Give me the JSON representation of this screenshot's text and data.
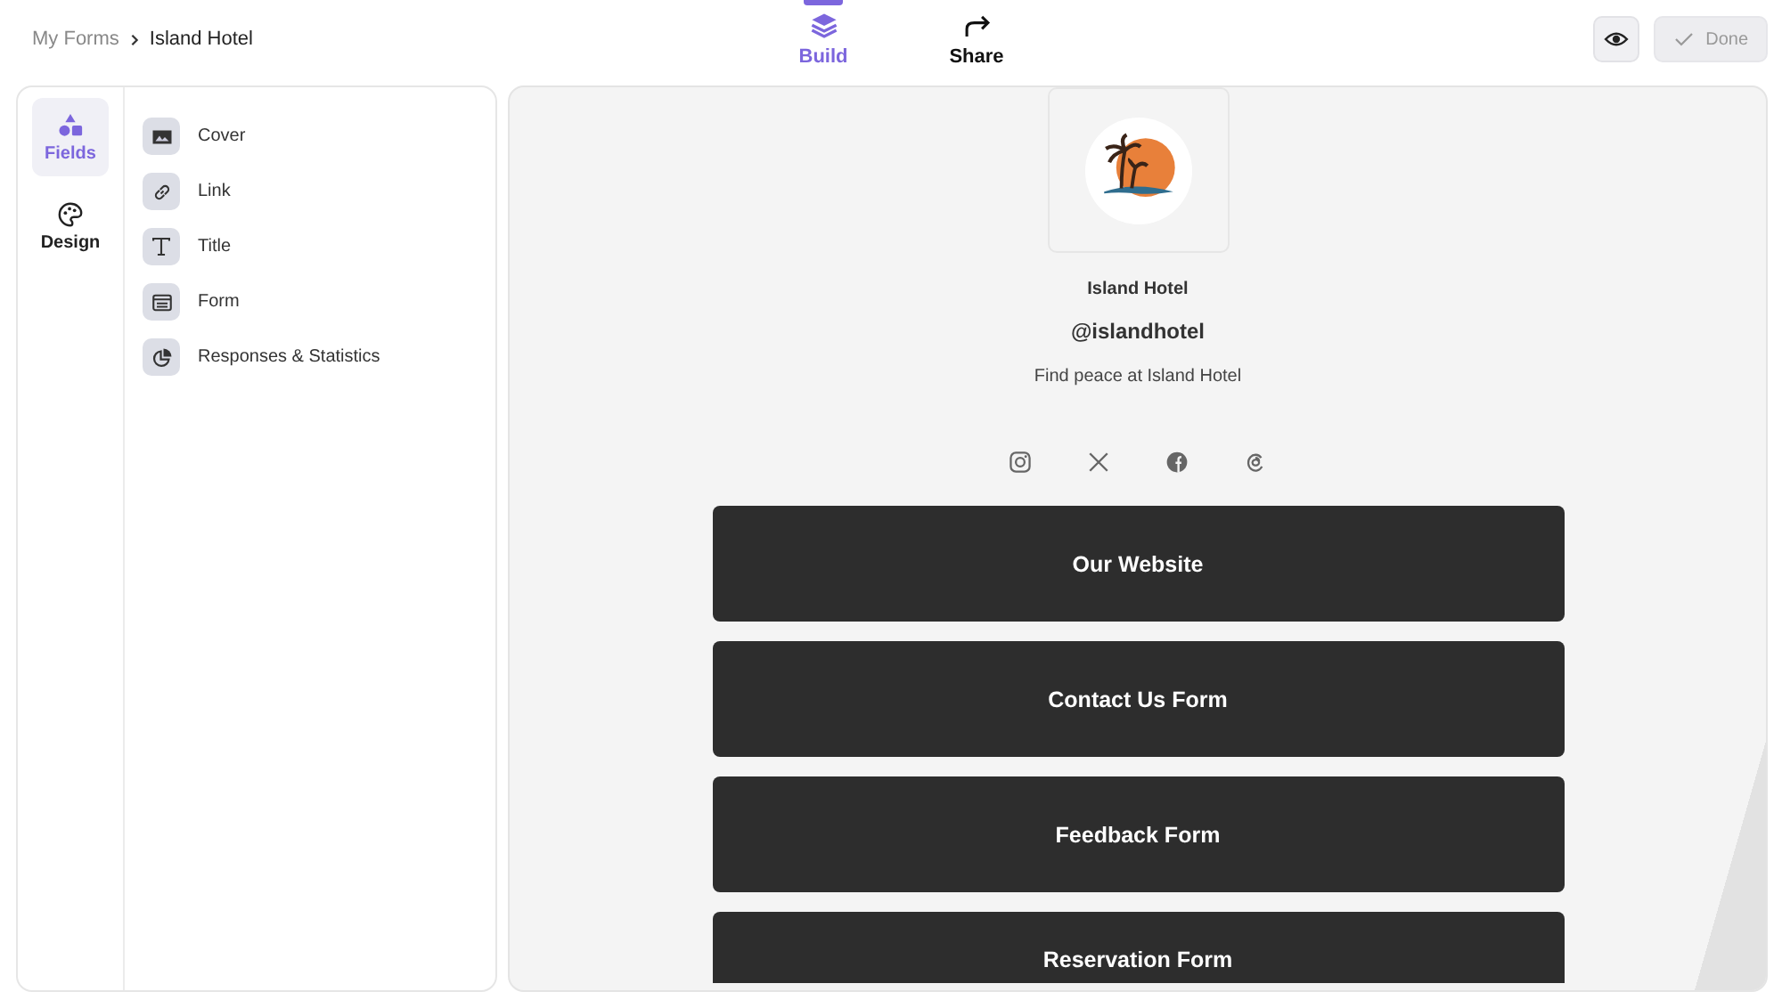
{
  "breadcrumb": [
    "My Forms",
    "Island Hotel"
  ],
  "tabs": [
    {
      "label": "Build",
      "kind": "build",
      "selected": true
    },
    {
      "label": "Share",
      "kind": "share",
      "selected": false
    }
  ],
  "actions": {
    "done": "Done"
  },
  "rail": [
    {
      "label": "Fields",
      "kind": "fields",
      "selected": true
    },
    {
      "label": "Design",
      "kind": "design",
      "selected": false
    }
  ],
  "fields": [
    {
      "label": "Cover",
      "kind": "cover"
    },
    {
      "label": "Link",
      "kind": "link"
    },
    {
      "label": "Title",
      "kind": "title"
    },
    {
      "label": "Form",
      "kind": "form"
    },
    {
      "label": "Responses & Statistics",
      "kind": "stats"
    }
  ],
  "profile": {
    "name": "Island Hotel",
    "handle": "@islandhotel",
    "bio": "Find peace at Island Hotel",
    "socials": [
      {
        "kind": "instagram"
      },
      {
        "kind": "x"
      },
      {
        "kind": "facebook"
      },
      {
        "kind": "threads"
      }
    ]
  },
  "links": [
    {
      "label": "Our Website"
    },
    {
      "label": "Contact Us Form"
    },
    {
      "label": "Feedback Form"
    },
    {
      "label": "Reservation Form"
    }
  ]
}
